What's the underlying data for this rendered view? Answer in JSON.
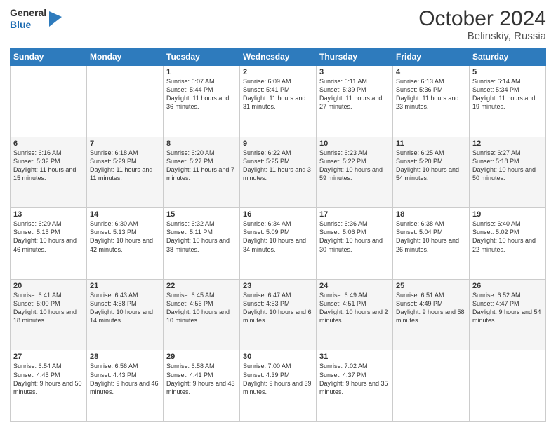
{
  "header": {
    "logo_general": "General",
    "logo_blue": "Blue",
    "title": "October 2024",
    "subtitle": "Belinskiy, Russia"
  },
  "columns": [
    "Sunday",
    "Monday",
    "Tuesday",
    "Wednesday",
    "Thursday",
    "Friday",
    "Saturday"
  ],
  "weeks": [
    [
      {
        "day": "",
        "sunrise": "",
        "sunset": "",
        "daylight": ""
      },
      {
        "day": "",
        "sunrise": "",
        "sunset": "",
        "daylight": ""
      },
      {
        "day": "1",
        "sunrise": "Sunrise: 6:07 AM",
        "sunset": "Sunset: 5:44 PM",
        "daylight": "Daylight: 11 hours and 36 minutes."
      },
      {
        "day": "2",
        "sunrise": "Sunrise: 6:09 AM",
        "sunset": "Sunset: 5:41 PM",
        "daylight": "Daylight: 11 hours and 31 minutes."
      },
      {
        "day": "3",
        "sunrise": "Sunrise: 6:11 AM",
        "sunset": "Sunset: 5:39 PM",
        "daylight": "Daylight: 11 hours and 27 minutes."
      },
      {
        "day": "4",
        "sunrise": "Sunrise: 6:13 AM",
        "sunset": "Sunset: 5:36 PM",
        "daylight": "Daylight: 11 hours and 23 minutes."
      },
      {
        "day": "5",
        "sunrise": "Sunrise: 6:14 AM",
        "sunset": "Sunset: 5:34 PM",
        "daylight": "Daylight: 11 hours and 19 minutes."
      }
    ],
    [
      {
        "day": "6",
        "sunrise": "Sunrise: 6:16 AM",
        "sunset": "Sunset: 5:32 PM",
        "daylight": "Daylight: 11 hours and 15 minutes."
      },
      {
        "day": "7",
        "sunrise": "Sunrise: 6:18 AM",
        "sunset": "Sunset: 5:29 PM",
        "daylight": "Daylight: 11 hours and 11 minutes."
      },
      {
        "day": "8",
        "sunrise": "Sunrise: 6:20 AM",
        "sunset": "Sunset: 5:27 PM",
        "daylight": "Daylight: 11 hours and 7 minutes."
      },
      {
        "day": "9",
        "sunrise": "Sunrise: 6:22 AM",
        "sunset": "Sunset: 5:25 PM",
        "daylight": "Daylight: 11 hours and 3 minutes."
      },
      {
        "day": "10",
        "sunrise": "Sunrise: 6:23 AM",
        "sunset": "Sunset: 5:22 PM",
        "daylight": "Daylight: 10 hours and 59 minutes."
      },
      {
        "day": "11",
        "sunrise": "Sunrise: 6:25 AM",
        "sunset": "Sunset: 5:20 PM",
        "daylight": "Daylight: 10 hours and 54 minutes."
      },
      {
        "day": "12",
        "sunrise": "Sunrise: 6:27 AM",
        "sunset": "Sunset: 5:18 PM",
        "daylight": "Daylight: 10 hours and 50 minutes."
      }
    ],
    [
      {
        "day": "13",
        "sunrise": "Sunrise: 6:29 AM",
        "sunset": "Sunset: 5:15 PM",
        "daylight": "Daylight: 10 hours and 46 minutes."
      },
      {
        "day": "14",
        "sunrise": "Sunrise: 6:30 AM",
        "sunset": "Sunset: 5:13 PM",
        "daylight": "Daylight: 10 hours and 42 minutes."
      },
      {
        "day": "15",
        "sunrise": "Sunrise: 6:32 AM",
        "sunset": "Sunset: 5:11 PM",
        "daylight": "Daylight: 10 hours and 38 minutes."
      },
      {
        "day": "16",
        "sunrise": "Sunrise: 6:34 AM",
        "sunset": "Sunset: 5:09 PM",
        "daylight": "Daylight: 10 hours and 34 minutes."
      },
      {
        "day": "17",
        "sunrise": "Sunrise: 6:36 AM",
        "sunset": "Sunset: 5:06 PM",
        "daylight": "Daylight: 10 hours and 30 minutes."
      },
      {
        "day": "18",
        "sunrise": "Sunrise: 6:38 AM",
        "sunset": "Sunset: 5:04 PM",
        "daylight": "Daylight: 10 hours and 26 minutes."
      },
      {
        "day": "19",
        "sunrise": "Sunrise: 6:40 AM",
        "sunset": "Sunset: 5:02 PM",
        "daylight": "Daylight: 10 hours and 22 minutes."
      }
    ],
    [
      {
        "day": "20",
        "sunrise": "Sunrise: 6:41 AM",
        "sunset": "Sunset: 5:00 PM",
        "daylight": "Daylight: 10 hours and 18 minutes."
      },
      {
        "day": "21",
        "sunrise": "Sunrise: 6:43 AM",
        "sunset": "Sunset: 4:58 PM",
        "daylight": "Daylight: 10 hours and 14 minutes."
      },
      {
        "day": "22",
        "sunrise": "Sunrise: 6:45 AM",
        "sunset": "Sunset: 4:56 PM",
        "daylight": "Daylight: 10 hours and 10 minutes."
      },
      {
        "day": "23",
        "sunrise": "Sunrise: 6:47 AM",
        "sunset": "Sunset: 4:53 PM",
        "daylight": "Daylight: 10 hours and 6 minutes."
      },
      {
        "day": "24",
        "sunrise": "Sunrise: 6:49 AM",
        "sunset": "Sunset: 4:51 PM",
        "daylight": "Daylight: 10 hours and 2 minutes."
      },
      {
        "day": "25",
        "sunrise": "Sunrise: 6:51 AM",
        "sunset": "Sunset: 4:49 PM",
        "daylight": "Daylight: 9 hours and 58 minutes."
      },
      {
        "day": "26",
        "sunrise": "Sunrise: 6:52 AM",
        "sunset": "Sunset: 4:47 PM",
        "daylight": "Daylight: 9 hours and 54 minutes."
      }
    ],
    [
      {
        "day": "27",
        "sunrise": "Sunrise: 6:54 AM",
        "sunset": "Sunset: 4:45 PM",
        "daylight": "Daylight: 9 hours and 50 minutes."
      },
      {
        "day": "28",
        "sunrise": "Sunrise: 6:56 AM",
        "sunset": "Sunset: 4:43 PM",
        "daylight": "Daylight: 9 hours and 46 minutes."
      },
      {
        "day": "29",
        "sunrise": "Sunrise: 6:58 AM",
        "sunset": "Sunset: 4:41 PM",
        "daylight": "Daylight: 9 hours and 43 minutes."
      },
      {
        "day": "30",
        "sunrise": "Sunrise: 7:00 AM",
        "sunset": "Sunset: 4:39 PM",
        "daylight": "Daylight: 9 hours and 39 minutes."
      },
      {
        "day": "31",
        "sunrise": "Sunrise: 7:02 AM",
        "sunset": "Sunset: 4:37 PM",
        "daylight": "Daylight: 9 hours and 35 minutes."
      },
      {
        "day": "",
        "sunrise": "",
        "sunset": "",
        "daylight": ""
      },
      {
        "day": "",
        "sunrise": "",
        "sunset": "",
        "daylight": ""
      }
    ]
  ]
}
